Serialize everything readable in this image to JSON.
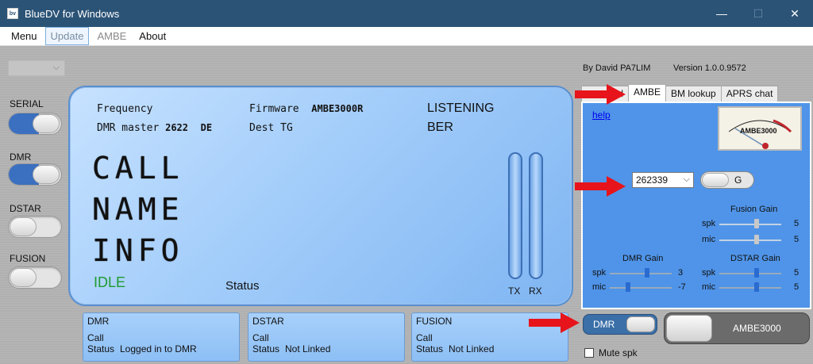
{
  "window": {
    "title": "BlueDV for Windows",
    "icon_text": "bv",
    "minimize": "—",
    "maximize": "☐",
    "close": "✕"
  },
  "menu": [
    "Menu",
    "Update",
    "AMBE",
    "About"
  ],
  "left": {
    "serial_label": "SERIAL",
    "dmr_label": "DMR",
    "dstar_label": "DSTAR",
    "fusion_label": "FUSION"
  },
  "lcd": {
    "frequency_label": "Frequency",
    "dmr_master_label": "DMR master",
    "dmr_master_value": "2622",
    "dmr_master_country": "DE",
    "firmware_label": "Firmware",
    "firmware_value": "AMBE3000R",
    "dest_tg_label": "Dest TG",
    "listening": "LISTENING",
    "ber": "BER",
    "call": "CALL",
    "name": "NAME",
    "info": "INFO",
    "idle": "IDLE",
    "status": "Status",
    "tx": "TX",
    "rx": "RX"
  },
  "header": {
    "author": "By David PA7LIM",
    "version": "Version 1.0.0.9572"
  },
  "tabs": {
    "items": [
      "d",
      "AMBE",
      "BM lookup",
      "APRS chat"
    ],
    "selected": "AMBE"
  },
  "ambe_tab": {
    "help": "help",
    "vu_title": "AMBE3000",
    "dmr_id": "262339",
    "g_label": "G",
    "fusion_gain": {
      "title": "Fusion Gain",
      "spk_label": "spk",
      "mic_label": "mic",
      "spk": 5,
      "mic": 5
    },
    "dmr_gain": {
      "title": "DMR Gain",
      "spk_label": "spk",
      "mic_label": "mic",
      "spk": 3,
      "mic": -7
    },
    "dstar_gain": {
      "title": "DSTAR Gain",
      "spk_label": "spk",
      "mic_label": "mic",
      "spk": 5,
      "mic": 5
    }
  },
  "modes": [
    {
      "title": "DMR",
      "call_label": "Call",
      "status_label": "Status",
      "status": "Logged in to DMR"
    },
    {
      "title": "DSTAR",
      "call_label": "Call",
      "status_label": "Status",
      "status": "Not Linked"
    },
    {
      "title": "FUSION",
      "call_label": "Call",
      "status_label": "Status",
      "status": "Not Linked"
    }
  ],
  "controls": {
    "dmr_switch": "DMR",
    "ambe_switch": "AMBE3000",
    "mute": "Mute spk"
  },
  "colors": {
    "titlebar": "#2b5376",
    "lcd": "#a3cdfa",
    "idle": "#1f9b2f",
    "panel": "#4f94e8",
    "arrow": "#e8141b"
  }
}
